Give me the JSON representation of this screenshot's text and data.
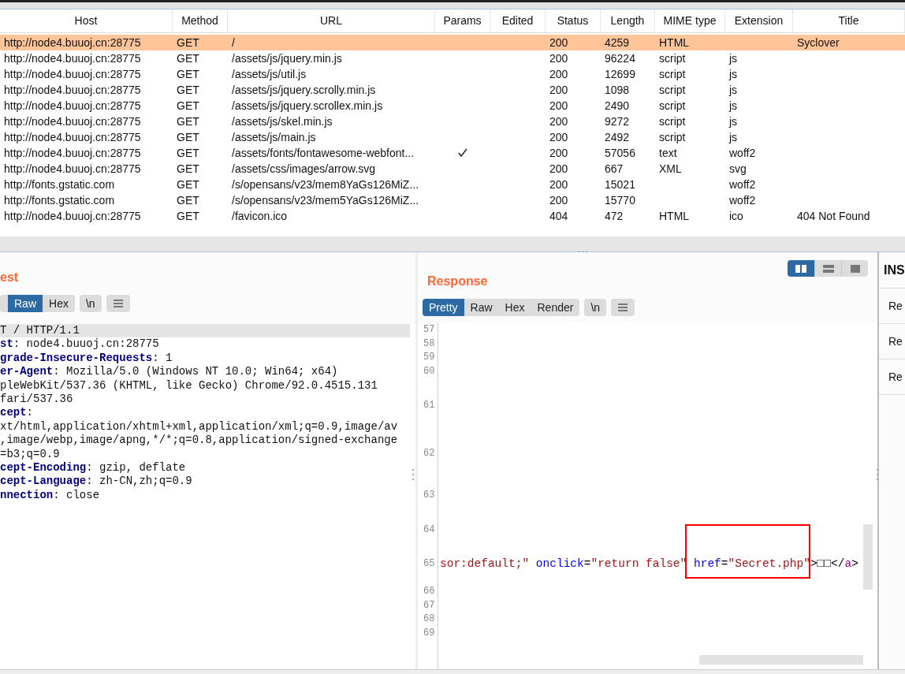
{
  "table": {
    "columns": [
      "Host",
      "Method",
      "URL",
      "Params",
      "Edited",
      "Status",
      "Length",
      "MIME type",
      "Extension",
      "Title"
    ],
    "rows": [
      {
        "host": "http://node4.buuoj.cn:28775",
        "method": "GET",
        "url": "/",
        "params": false,
        "status": "200",
        "length": "4259",
        "mime": "HTML",
        "extension": "",
        "title": "Syclover",
        "selected": true
      },
      {
        "host": "http://node4.buuoj.cn:28775",
        "method": "GET",
        "url": "/assets/js/jquery.min.js",
        "params": false,
        "status": "200",
        "length": "96224",
        "mime": "script",
        "extension": "js",
        "title": "",
        "selected": false
      },
      {
        "host": "http://node4.buuoj.cn:28775",
        "method": "GET",
        "url": "/assets/js/util.js",
        "params": false,
        "status": "200",
        "length": "12699",
        "mime": "script",
        "extension": "js",
        "title": "",
        "selected": false
      },
      {
        "host": "http://node4.buuoj.cn:28775",
        "method": "GET",
        "url": "/assets/js/jquery.scrolly.min.js",
        "params": false,
        "status": "200",
        "length": "1098",
        "mime": "script",
        "extension": "js",
        "title": "",
        "selected": false
      },
      {
        "host": "http://node4.buuoj.cn:28775",
        "method": "GET",
        "url": "/assets/js/jquery.scrollex.min.js",
        "params": false,
        "status": "200",
        "length": "2490",
        "mime": "script",
        "extension": "js",
        "title": "",
        "selected": false
      },
      {
        "host": "http://node4.buuoj.cn:28775",
        "method": "GET",
        "url": "/assets/js/skel.min.js",
        "params": false,
        "status": "200",
        "length": "9272",
        "mime": "script",
        "extension": "js",
        "title": "",
        "selected": false
      },
      {
        "host": "http://node4.buuoj.cn:28775",
        "method": "GET",
        "url": "/assets/js/main.js",
        "params": false,
        "status": "200",
        "length": "2492",
        "mime": "script",
        "extension": "js",
        "title": "",
        "selected": false
      },
      {
        "host": "http://node4.buuoj.cn:28775",
        "method": "GET",
        "url": "/assets/fonts/fontawesome-webfont...",
        "params": true,
        "status": "200",
        "length": "57056",
        "mime": "text",
        "extension": "woff2",
        "title": "",
        "selected": false
      },
      {
        "host": "http://node4.buuoj.cn:28775",
        "method": "GET",
        "url": "/assets/css/images/arrow.svg",
        "params": false,
        "status": "200",
        "length": "667",
        "mime": "XML",
        "extension": "svg",
        "title": "",
        "selected": false
      },
      {
        "host": "http://fonts.gstatic.com",
        "method": "GET",
        "url": "/s/opensans/v23/mem8YaGs126MiZ...",
        "params": false,
        "status": "200",
        "length": "15021",
        "mime": "",
        "extension": "woff2",
        "title": "",
        "selected": false
      },
      {
        "host": "http://fonts.gstatic.com",
        "method": "GET",
        "url": "/s/opensans/v23/mem5YaGs126MiZ...",
        "params": false,
        "status": "200",
        "length": "15770",
        "mime": "",
        "extension": "woff2",
        "title": "",
        "selected": false
      },
      {
        "host": "http://node4.buuoj.cn:28775",
        "method": "GET",
        "url": "/favicon.ico",
        "params": false,
        "status": "404",
        "length": "472",
        "mime": "HTML",
        "extension": "ico",
        "title": "404 Not Found",
        "selected": false
      }
    ]
  },
  "request": {
    "title": "est",
    "tabs": [
      {
        "label": "Raw",
        "selected": true
      },
      {
        "label": "Hex",
        "selected": false
      }
    ],
    "toggles": [
      "\\n"
    ],
    "lines": [
      {
        "kind": "plain",
        "text": "T / HTTP/1.1",
        "selected": true
      },
      {
        "kind": "header",
        "name": "st",
        "value": ": node4.buuoj.cn:28775",
        "selected": false
      },
      {
        "kind": "header",
        "name": "grade-Insecure-Requests",
        "value": ": 1",
        "selected": false
      },
      {
        "kind": "header",
        "name": "er-Agent",
        "value": ": Mozilla/5.0 (Windows NT 10.0; Win64; x64)",
        "selected": false
      },
      {
        "kind": "plain",
        "text": "pleWebKit/537.36 (KHTML, like Gecko) Chrome/92.0.4515.131",
        "selected": false
      },
      {
        "kind": "plain",
        "text": "fari/537.36",
        "selected": false
      },
      {
        "kind": "header",
        "name": "cept",
        "value": ":",
        "selected": false
      },
      {
        "kind": "plain",
        "text": "xt/html,application/xhtml+xml,application/xml;q=0.9,image/av",
        "selected": false
      },
      {
        "kind": "plain",
        "text": ",image/webp,image/apng,*/*;q=0.8,application/signed-exchange",
        "selected": false
      },
      {
        "kind": "plain",
        "text": "=b3;q=0.9",
        "selected": false
      },
      {
        "kind": "header",
        "name": "cept-Encoding",
        "value": ": gzip, deflate",
        "selected": false
      },
      {
        "kind": "header",
        "name": "cept-Language",
        "value": ": zh-CN,zh;q=0.9",
        "selected": false
      },
      {
        "kind": "header",
        "name": "nnection",
        "value": ": close",
        "selected": false
      }
    ]
  },
  "response": {
    "title": "Response",
    "tabs": [
      {
        "label": "Pretty",
        "selected": true
      },
      {
        "label": "Raw",
        "selected": false
      },
      {
        "label": "Hex",
        "selected": false
      },
      {
        "label": "Render",
        "selected": false
      }
    ],
    "toggles": [
      "\\n"
    ],
    "layout_buttons": [
      {
        "kind": "split",
        "selected": true
      },
      {
        "kind": "stacked",
        "selected": false
      },
      {
        "kind": "single",
        "selected": false
      }
    ],
    "lines": [
      {
        "number": "57"
      },
      {
        "number": "58"
      },
      {
        "number": "59"
      },
      {
        "number": "60"
      },
      {
        "number": "61"
      },
      {
        "number": "62"
      },
      {
        "number": "63"
      },
      {
        "number": "64"
      },
      {
        "number": "65",
        "tokens": [
          {
            "kind": "value",
            "text": "sor:default;\" "
          },
          {
            "kind": "attr",
            "text": "onclick"
          },
          {
            "kind": "punct",
            "text": "="
          },
          {
            "kind": "value",
            "text": "\"return false\" "
          },
          {
            "kind": "attr",
            "text": "href"
          },
          {
            "kind": "punct",
            "text": "="
          },
          {
            "kind": "value",
            "text": "\"Secret.php\""
          },
          {
            "kind": "punct",
            "text": ">□□"
          },
          {
            "kind": "punct",
            "text": "</"
          },
          {
            "kind": "tag",
            "text": "a"
          },
          {
            "kind": "punct",
            "text": ">"
          }
        ]
      },
      {
        "number": "66"
      },
      {
        "number": "67"
      },
      {
        "number": "68"
      },
      {
        "number": "69"
      }
    ]
  },
  "inspector": {
    "title": "INS",
    "rows": [
      "Re",
      "Re",
      "Re"
    ]
  }
}
